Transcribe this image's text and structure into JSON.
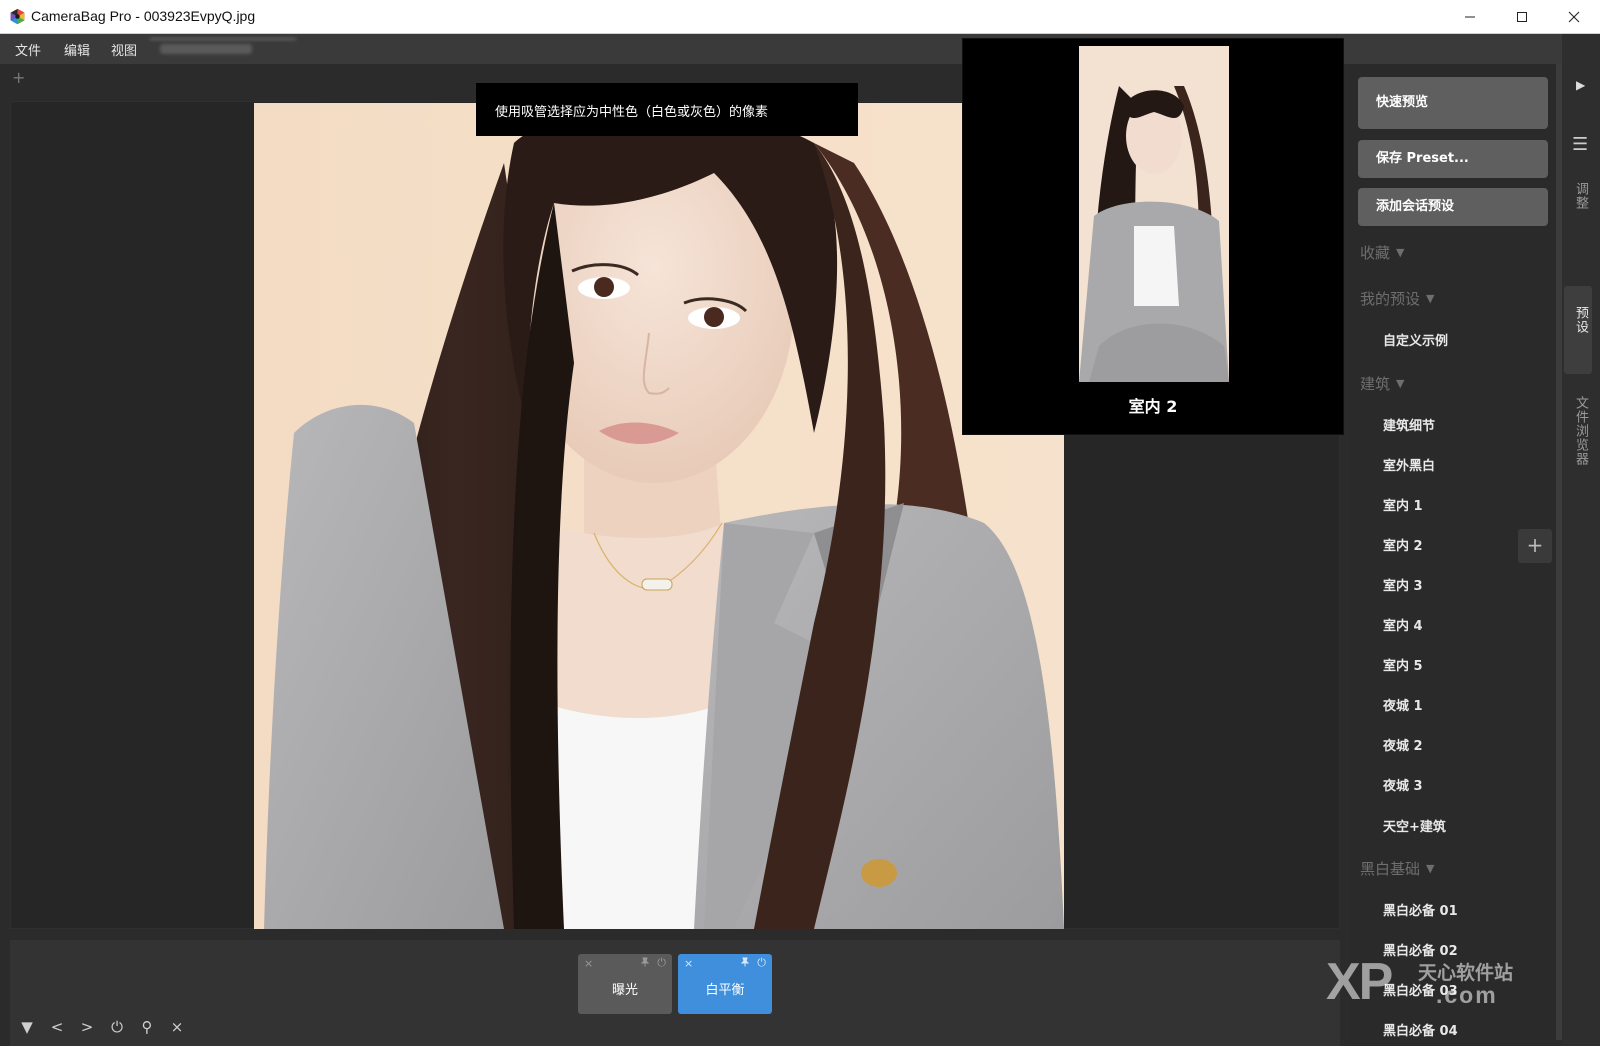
{
  "window": {
    "title": "CameraBag Pro - 003923EvpyQ.jpg"
  },
  "menu": {
    "file": "文件",
    "edit": "编辑",
    "view": "视图"
  },
  "tabs": {
    "add": "+"
  },
  "tooltip": {
    "text": "使用吸管选择应为中性色（白色或灰色）的像素"
  },
  "preview": {
    "label": "室内 2"
  },
  "adjustments": {
    "cards": [
      {
        "label": "曝光",
        "close": "×",
        "pin": "📌",
        "power": "⏻",
        "active": false
      },
      {
        "label": "白平衡",
        "close": "×",
        "pin": "📌",
        "power": "⏻",
        "active": true
      }
    ]
  },
  "bottom_tools": [
    "▼",
    "<",
    ">",
    "⏻",
    "⚲",
    "×"
  ],
  "presets_panel": {
    "quick_preview": "快速预览",
    "save_preset": "保存 Preset...",
    "add_session_preset": "添加会话预设",
    "sections": [
      {
        "title": "收藏",
        "items": []
      },
      {
        "title": "我的预设",
        "items": [
          "自定义示例"
        ]
      },
      {
        "title": "建筑",
        "items": [
          "建筑细节",
          "室外黑白",
          "室内 1",
          "室内 2",
          "室内 3",
          "室内 4",
          "室内 5",
          "夜城 1",
          "夜城 2",
          "夜城 3",
          "天空+建筑"
        ]
      },
      {
        "title": "黑白基础",
        "items": [
          "黑白必备 01",
          "黑白必备 02",
          "黑白必备 03",
          "黑白必备 04"
        ]
      }
    ],
    "add_button": "+"
  },
  "side_tabs": {
    "adjust": "调整",
    "presets": "预设",
    "file_browser": "文件浏览器"
  },
  "watermark": {
    "xp": "XP",
    "cn": "天心软件站",
    "com": ".com"
  },
  "colors": {
    "accent_blue": "#3f8fdc",
    "panel_bg": "#2a2a2a",
    "button_bg": "#5f5f5f"
  }
}
